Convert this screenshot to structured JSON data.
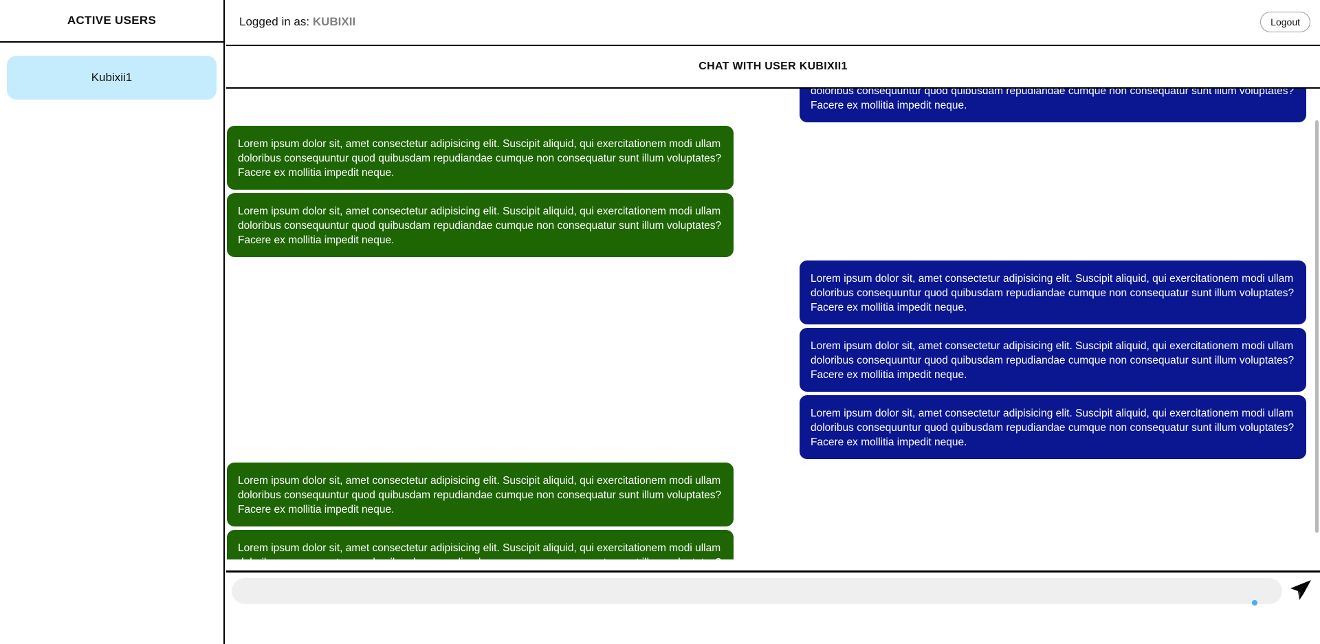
{
  "sidebar": {
    "title": "ACTIVE USERS",
    "users": [
      {
        "label": "Kubixii1"
      }
    ]
  },
  "header": {
    "logged_in_prefix": "Logged in as: ",
    "username": "KUBIXII",
    "logout_label": "Logout"
  },
  "chat": {
    "title": "CHAT WITH USER KUBIXII1",
    "messages": [
      {
        "side": "sent",
        "text": "Lorem ipsum dolor sit, amet consectetur adipisicing elit. Suscipit aliquid, qui exercitationem modi ullam doloribus consequuntur quod quibusdam repudiandae cumque non consequatur sunt illum voluptates? Facere ex mollitia impedit neque."
      },
      {
        "side": "received",
        "text": "Lorem ipsum dolor sit, amet consectetur adipisicing elit. Suscipit aliquid, qui exercitationem modi ullam doloribus consequuntur quod quibusdam repudiandae cumque non consequatur sunt illum voluptates? Facere ex mollitia impedit neque."
      },
      {
        "side": "received",
        "text": "Lorem ipsum dolor sit, amet consectetur adipisicing elit. Suscipit aliquid, qui exercitationem modi ullam doloribus consequuntur quod quibusdam repudiandae cumque non consequatur sunt illum voluptates? Facere ex mollitia impedit neque."
      },
      {
        "side": "sent",
        "text": "Lorem ipsum dolor sit, amet consectetur adipisicing elit. Suscipit aliquid, qui exercitationem modi ullam doloribus consequuntur quod quibusdam repudiandae cumque non consequatur sunt illum voluptates? Facere ex mollitia impedit neque."
      },
      {
        "side": "sent",
        "text": "Lorem ipsum dolor sit, amet consectetur adipisicing elit. Suscipit aliquid, qui exercitationem modi ullam doloribus consequuntur quod quibusdam repudiandae cumque non consequatur sunt illum voluptates? Facere ex mollitia impedit neque."
      },
      {
        "side": "sent",
        "text": "Lorem ipsum dolor sit, amet consectetur adipisicing elit. Suscipit aliquid, qui exercitationem modi ullam doloribus consequuntur quod quibusdam repudiandae cumque non consequatur sunt illum voluptates? Facere ex mollitia impedit neque."
      },
      {
        "side": "received",
        "text": "Lorem ipsum dolor sit, amet consectetur adipisicing elit. Suscipit aliquid, qui exercitationem modi ullam doloribus consequuntur quod quibusdam repudiandae cumque non consequatur sunt illum voluptates? Facere ex mollitia impedit neque."
      },
      {
        "side": "received",
        "text": "Lorem ipsum dolor sit, amet consectetur adipisicing elit. Suscipit aliquid, qui exercitationem modi ullam doloribus consequuntur quod quibusdam repudiandae cumque non consequatur sunt illum voluptates? Facere ex mollitia impedit neque."
      }
    ]
  },
  "composer": {
    "value": "",
    "placeholder": "",
    "send_icon": "paper-plane-icon"
  },
  "colors": {
    "received_bubble": "#1e6504",
    "sent_bubble": "#0b1790",
    "active_user_bg": "#c5ecfd",
    "username_accent": "#808080",
    "typing_indicator": "#46b2e8"
  }
}
